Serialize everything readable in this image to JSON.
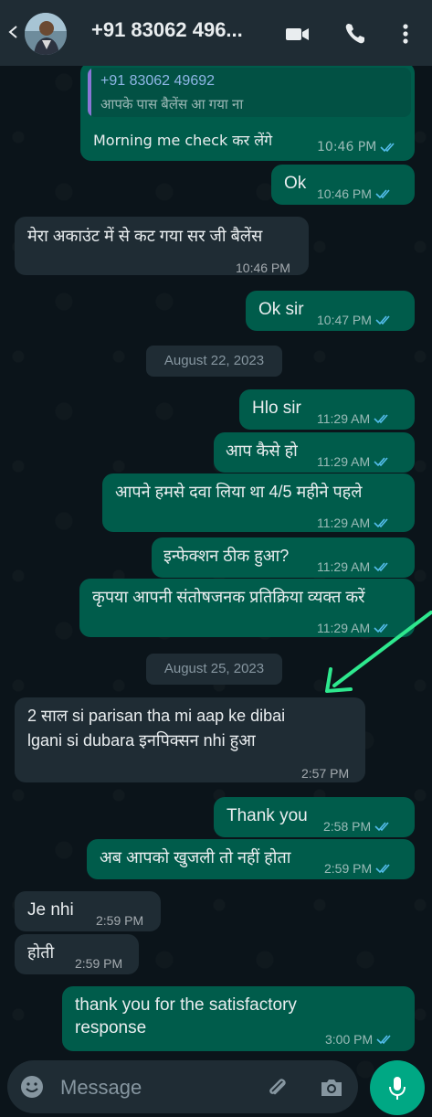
{
  "header": {
    "contact_name": "+91 83062 496..."
  },
  "quoted": {
    "name": "+91 83062 49692",
    "text": "आपके पास बैलेंस आ गया ना"
  },
  "messages": [
    {
      "dir": "out",
      "text": "Morning me check कर लेंगे",
      "time": "10:46 PM"
    },
    {
      "dir": "out",
      "text": "Ok",
      "time": "10:46 PM"
    },
    {
      "dir": "in",
      "text": "मेरा अकाउंट में से कट गया सर जी बैलेंस",
      "time": "10:46 PM"
    },
    {
      "dir": "out",
      "text": "Ok sir",
      "time": "10:47 PM"
    },
    {
      "dir": "out",
      "text": "Hlo sir",
      "time": "11:29 AM"
    },
    {
      "dir": "out",
      "text": "आप कैसे हो",
      "time": "11:29 AM"
    },
    {
      "dir": "out",
      "text": "आपने हमसे दवा लिया था 4/5 महीने पहले",
      "time": "11:29 AM"
    },
    {
      "dir": "out",
      "text": "इन्फेक्शन ठीक हुआ?",
      "time": "11:29 AM"
    },
    {
      "dir": "out",
      "text": "कृपया आपनी संतोषजनक प्रतिक्रिया व्यक्त करें",
      "time": "11:29 AM"
    },
    {
      "dir": "in",
      "text_line1": "2 साल si parisan tha mi aap ke dibai",
      "text_line2": "lgani si dubara इनपिक्सन nhi हुआ",
      "time": "2:57 PM"
    },
    {
      "dir": "out",
      "text": "Thank you",
      "time": "2:58 PM"
    },
    {
      "dir": "out",
      "text": "अब आपको खुजली तो नहीं होता",
      "time": "2:59 PM"
    },
    {
      "dir": "in",
      "text": "Je nhi",
      "time": "2:59 PM"
    },
    {
      "dir": "in",
      "text": "होती",
      "time": "2:59 PM"
    },
    {
      "dir": "out",
      "text_line1": "thank you for the satisfactory",
      "text_line2": "response",
      "time": "3:00 PM"
    }
  ],
  "dates": [
    "August 22, 2023",
    "August 25, 2023"
  ],
  "composer": {
    "placeholder": "Message"
  },
  "colors": {
    "background": "#0b141a",
    "outgoing_bubble": "#005c4b",
    "incoming_bubble": "#1f2c34",
    "read_ticks": "#53bdeb",
    "mic_button": "#00a884",
    "annotation_arrow": "#2ee88e"
  },
  "icons": [
    "back-arrow-icon",
    "video-call-icon",
    "phone-icon",
    "more-options-icon",
    "emoji-icon",
    "attach-icon",
    "camera-icon",
    "mic-icon",
    "read-ticks-icon"
  ]
}
